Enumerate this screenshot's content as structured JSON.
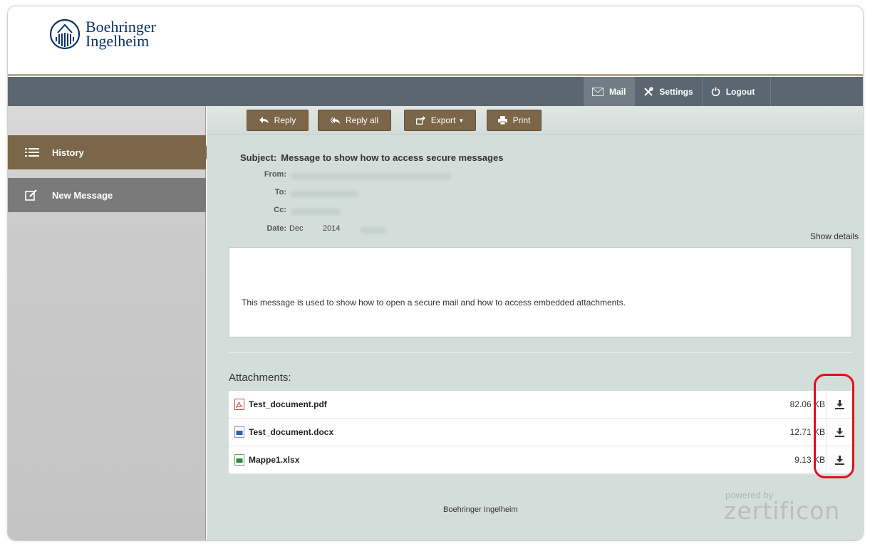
{
  "brand": {
    "line1": "Boehringer",
    "line2": "Ingelheim",
    "color": "#08316b"
  },
  "nav": {
    "mail": "Mail",
    "settings": "Settings",
    "logout": "Logout"
  },
  "sidebar": {
    "history": "History",
    "new_message": "New Message"
  },
  "toolbar": {
    "reply": "Reply",
    "reply_all": "Reply all",
    "export": "Export",
    "print": "Print"
  },
  "message": {
    "subject_label": "Subject:",
    "subject": "Message to show how to access secure messages",
    "from_label": "From:",
    "to_label": "To:",
    "cc_label": "Cc:",
    "date_label": "Date:",
    "date_month": "Dec",
    "date_year": "2014",
    "show_details": "Show details",
    "body": "This message is used to show how to open a secure mail and how to access embedded attachments."
  },
  "attachments": {
    "title": "Attachments:",
    "items": [
      {
        "name": "Test_document.pdf",
        "size": "82.06 KB",
        "icon": "pdf-file-icon"
      },
      {
        "name": "Test_document.docx",
        "size": "12.71 KB",
        "icon": "word-file-icon"
      },
      {
        "name": "Mappe1.xlsx",
        "size": "9.13 KB",
        "icon": "excel-file-icon"
      }
    ]
  },
  "footer": {
    "company": "Boehringer Ingelheim",
    "powered_by": "powered by",
    "vendor": "zertificon"
  },
  "colors": {
    "accent_brown": "#7c6649",
    "navbar": "#5a6670",
    "highlight_red": "#e0101b"
  }
}
